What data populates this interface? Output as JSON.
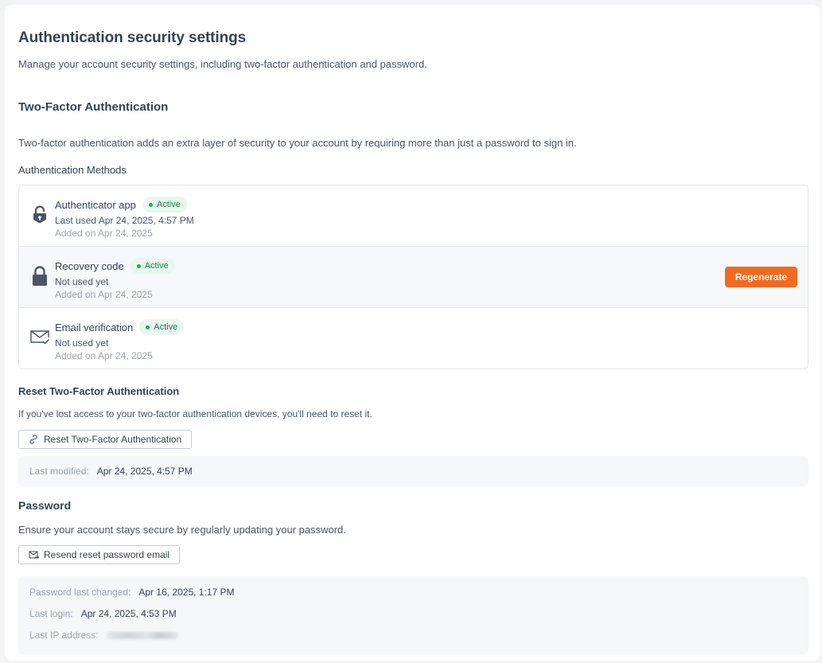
{
  "page": {
    "title": "Authentication security settings",
    "subtitle": "Manage your account security settings, including two-factor authentication and password."
  },
  "two_factor": {
    "title": "Two-Factor Authentication",
    "description": "Two-factor authentication adds an extra layer of security to your account by requiring more than just a password to sign in.",
    "methods_label": "Authentication Methods",
    "methods": [
      {
        "name": "Authenticator app",
        "status": "Active",
        "usage": "Last used Apr 24, 2025, 4:57 PM",
        "added": "Added on Apr 24, 2025",
        "icon": "lock-open-icon"
      },
      {
        "name": "Recovery code",
        "status": "Active",
        "usage": "Not used yet",
        "added": "Added on Apr 24, 2025",
        "icon": "padlock-icon",
        "action_label": "Regenerate"
      },
      {
        "name": "Email verification",
        "status": "Active",
        "usage": "Not used yet",
        "added": "Added on Apr 24, 2025",
        "icon": "envelope-check-icon"
      }
    ],
    "reset": {
      "title": "Reset Two-Factor Authentication",
      "description": "If you've lost access to your two-factor authentication devices, you'll need to reset it.",
      "button_label": "Reset Two-Factor Authentication",
      "button_icon": "link-break-icon"
    },
    "last_modified": {
      "label": "Last modified:",
      "value": "Apr 24, 2025, 4:57 PM"
    }
  },
  "password": {
    "title": "Password",
    "description": "Ensure your account stays secure by regularly updating your password.",
    "button_label": "Resend reset password email",
    "button_icon": "email-send-icon",
    "info": [
      {
        "label": "Password last changed:",
        "value": "Apr 16, 2025, 1:17 PM"
      },
      {
        "label": "Last login:",
        "value": "Apr 24, 2025, 4:53 PM"
      },
      {
        "label": "Last IP address:",
        "value": ""
      }
    ]
  },
  "colors": {
    "accent": "#f26a21",
    "active_badge_bg": "#e8f7ef",
    "active_dot": "#22a861",
    "text": "#374151"
  }
}
